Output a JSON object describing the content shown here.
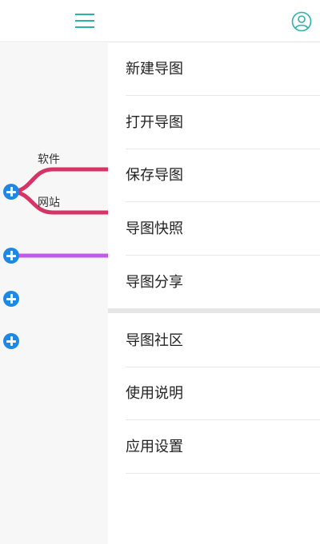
{
  "header": {
    "menu_icon": "hamburger-menu-icon",
    "user_icon": "user-circle-icon",
    "accent_color": "#2bb3a7"
  },
  "mindmap": {
    "nodes": [
      {
        "label": "软件",
        "branch_color": "#d63366"
      },
      {
        "label": "网站",
        "branch_color": "#d63366"
      }
    ],
    "branch_colors": [
      "#d63366",
      "#c05ae8"
    ],
    "expand_icon": "plus-circle-icon",
    "expand_color": "#1e88e5"
  },
  "menu": {
    "group1": [
      {
        "label": "新建导图"
      },
      {
        "label": "打开导图"
      },
      {
        "label": "保存导图"
      },
      {
        "label": "导图快照"
      },
      {
        "label": "导图分享"
      }
    ],
    "group2": [
      {
        "label": "导图社区"
      },
      {
        "label": "使用说明"
      },
      {
        "label": "应用设置"
      }
    ]
  }
}
